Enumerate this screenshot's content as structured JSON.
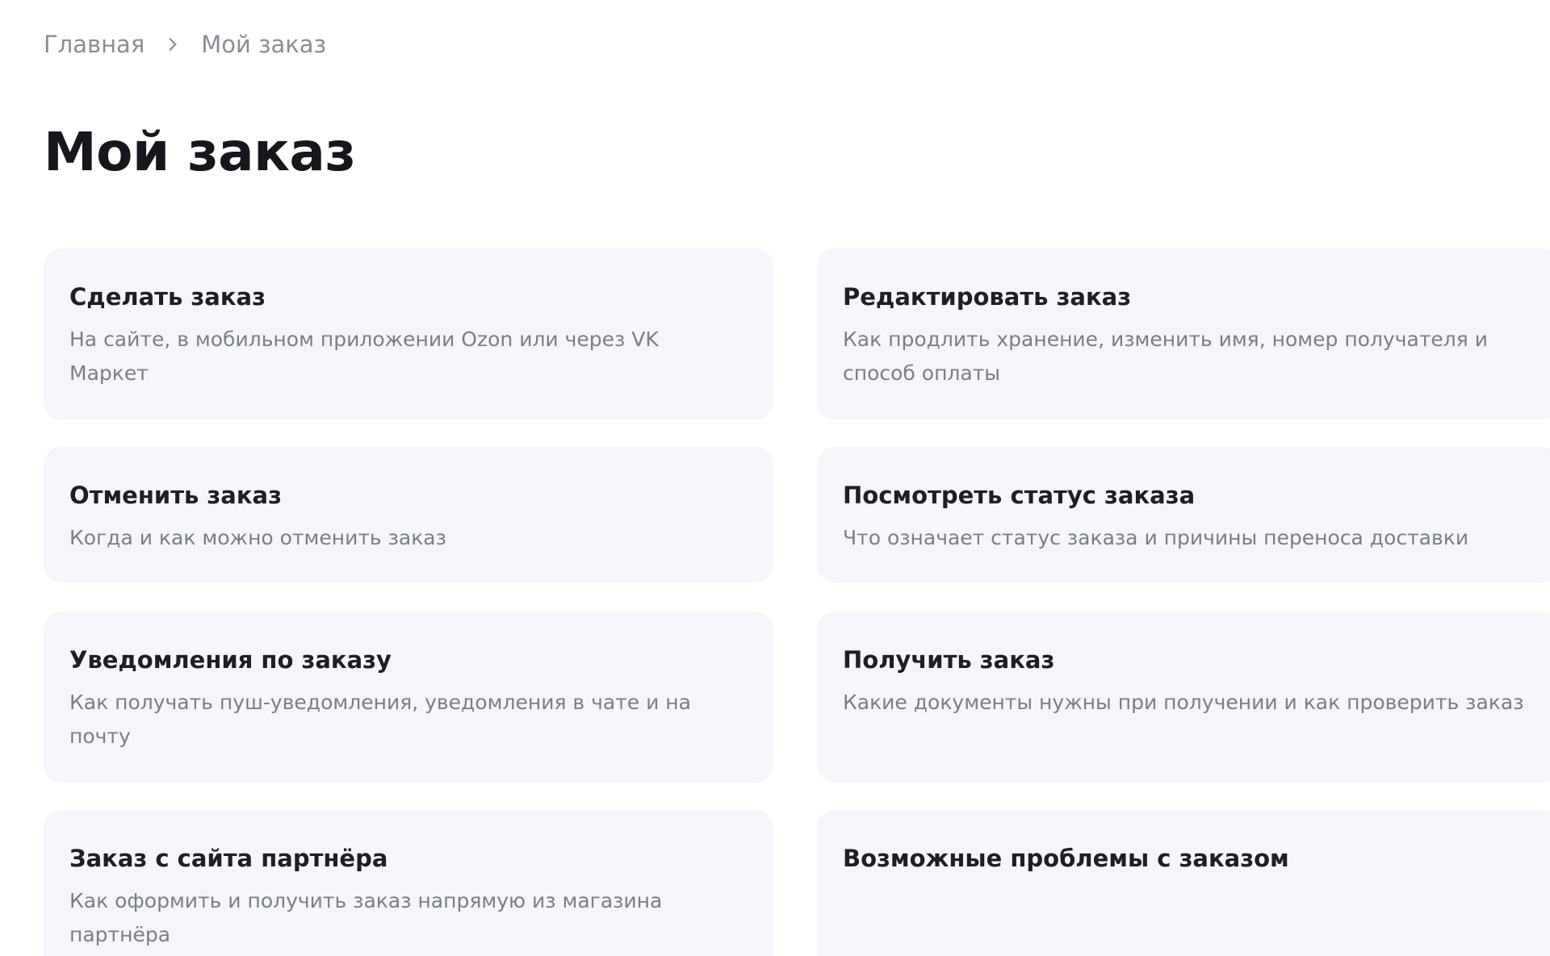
{
  "breadcrumb": {
    "home": "Главная",
    "current": "Мой заказ"
  },
  "page": {
    "title": "Мой заказ"
  },
  "cards": [
    {
      "title": "Сделать заказ",
      "description": "На сайте, в мобильном приложении Ozon или через VK Маркет"
    },
    {
      "title": "Редактировать заказ",
      "description": "Как продлить хранение, изменить имя, номер получателя и способ оплаты"
    },
    {
      "title": "Отменить заказ",
      "description": "Когда и как можно отменить заказ"
    },
    {
      "title": "Посмотреть статус заказа",
      "description": "Что означает статус заказа и причины переноса доставки"
    },
    {
      "title": "Уведомления по заказу",
      "description": "Как получать пуш-уведомления, уведомления в чате и на почту"
    },
    {
      "title": "Получить заказ",
      "description": "Какие документы нужны при получении и как проверить заказ"
    },
    {
      "title": "Заказ с сайта партнёра",
      "description": "Как оформить и получить заказ напрямую из магазина партнёра"
    },
    {
      "title": "Возможные проблемы с заказом",
      "description": ""
    }
  ],
  "colors": {
    "card_background": "#f5f6f9",
    "title_text": "#15171c",
    "muted_text": "#8a8d96"
  },
  "icons": {
    "breadcrumb_separator": "chevron-right-icon"
  }
}
